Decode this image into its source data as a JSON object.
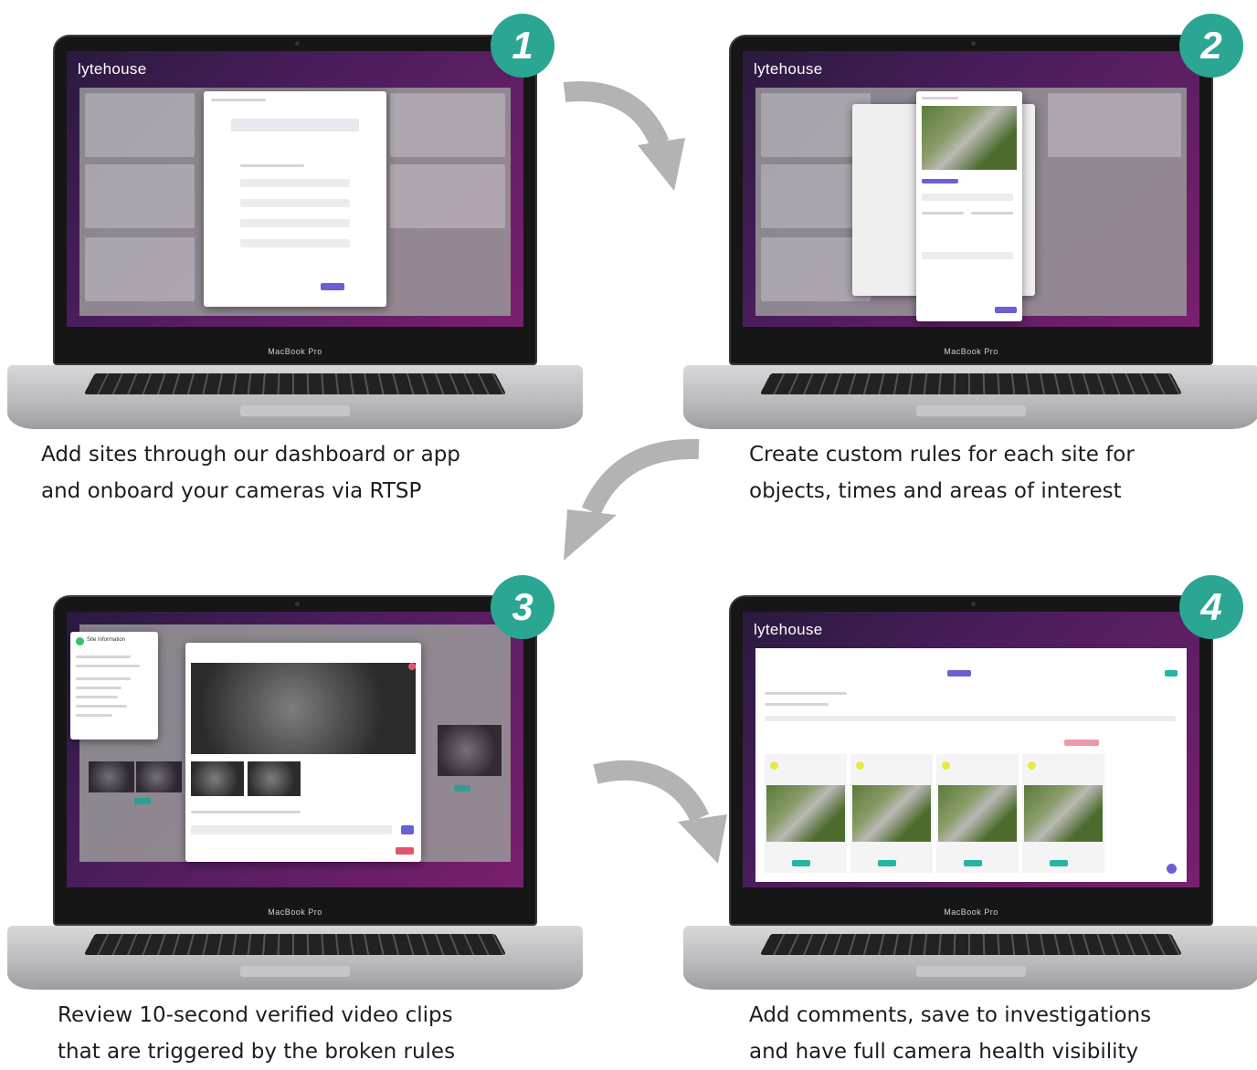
{
  "app": {
    "brand": "lytehouse",
    "device_label": "MacBook Pro"
  },
  "steps": [
    {
      "number": "1",
      "caption_line1": "Add sites through our dashboard or app",
      "caption_line2": "and onboard your cameras via RTSP"
    },
    {
      "number": "2",
      "caption_line1": "Create custom rules for each site for",
      "caption_line2": "objects, times and areas of interest"
    },
    {
      "number": "3",
      "caption_line1": "Review 10-second verified video clips",
      "caption_line2": "that are triggered by the broken rules"
    },
    {
      "number": "4",
      "caption_line1": "Add comments, save to investigations",
      "caption_line2": "and have full camera health visibility"
    }
  ],
  "colors": {
    "badge": "#2aa692",
    "arrow": "#b3b3b3",
    "accent_purple": "#6b5fd6",
    "accent_red": "#e0556e",
    "accent_teal": "#25b5a2"
  },
  "screen3": {
    "site_info_title": "Site Information"
  }
}
